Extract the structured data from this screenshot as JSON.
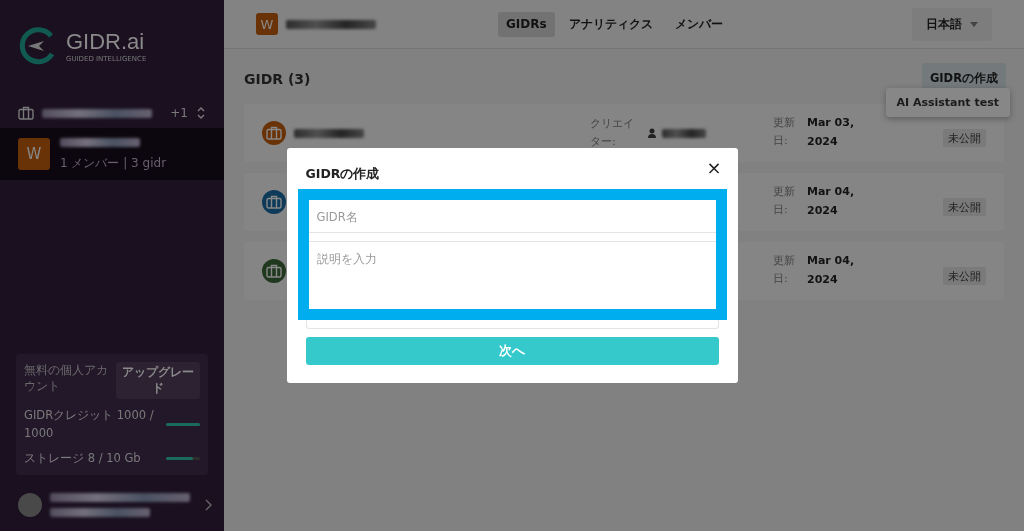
{
  "sidebar": {
    "logo": {
      "name": "GIDR.ai",
      "tagline": "GUIDED INTELLIGENCE"
    },
    "workspace_switcher": {
      "count": "+1"
    },
    "workspace": {
      "initial": "W",
      "meta": "1 メンバー | 3 gidr",
      "selected": true
    },
    "plan": {
      "label": "無料の個人アカウント",
      "upgrade": "アップグレード",
      "meters": [
        {
          "label": "GIDRクレジット 1000 / 1000",
          "level": 1.0
        },
        {
          "label": "ストレージ 8 / 10 Gb",
          "level": 0.8
        }
      ]
    }
  },
  "topbar": {
    "initial": "W",
    "tabs": [
      {
        "label": "GIDRs",
        "selected": true
      },
      {
        "label": "アナリティクス",
        "selected": false
      },
      {
        "label": "メンバー",
        "selected": false
      }
    ],
    "language": "日本語"
  },
  "heading": "GIDR (3)",
  "create_button": "GIDRの作成",
  "create_menu": [
    "AI Assistant test"
  ],
  "rows": [
    {
      "color": "#6a3307",
      "creator_label": "クリエイター:",
      "updated_label": "更新日:",
      "date": "Mar 03, 2024",
      "status": "未公開"
    },
    {
      "color": "#0e3b59",
      "updated_label": "更新日:",
      "date": "Mar 04, 2024",
      "status": "未公開"
    },
    {
      "color": "#20391e",
      "updated_label": "更新日:",
      "date": "Mar 04, 2024",
      "status": "未公開"
    }
  ],
  "modal": {
    "title": "GIDRの作成",
    "close": "×",
    "name_placeholder": "GIDR名",
    "description_placeholder": "説明を入力",
    "next_button": "次へ"
  }
}
